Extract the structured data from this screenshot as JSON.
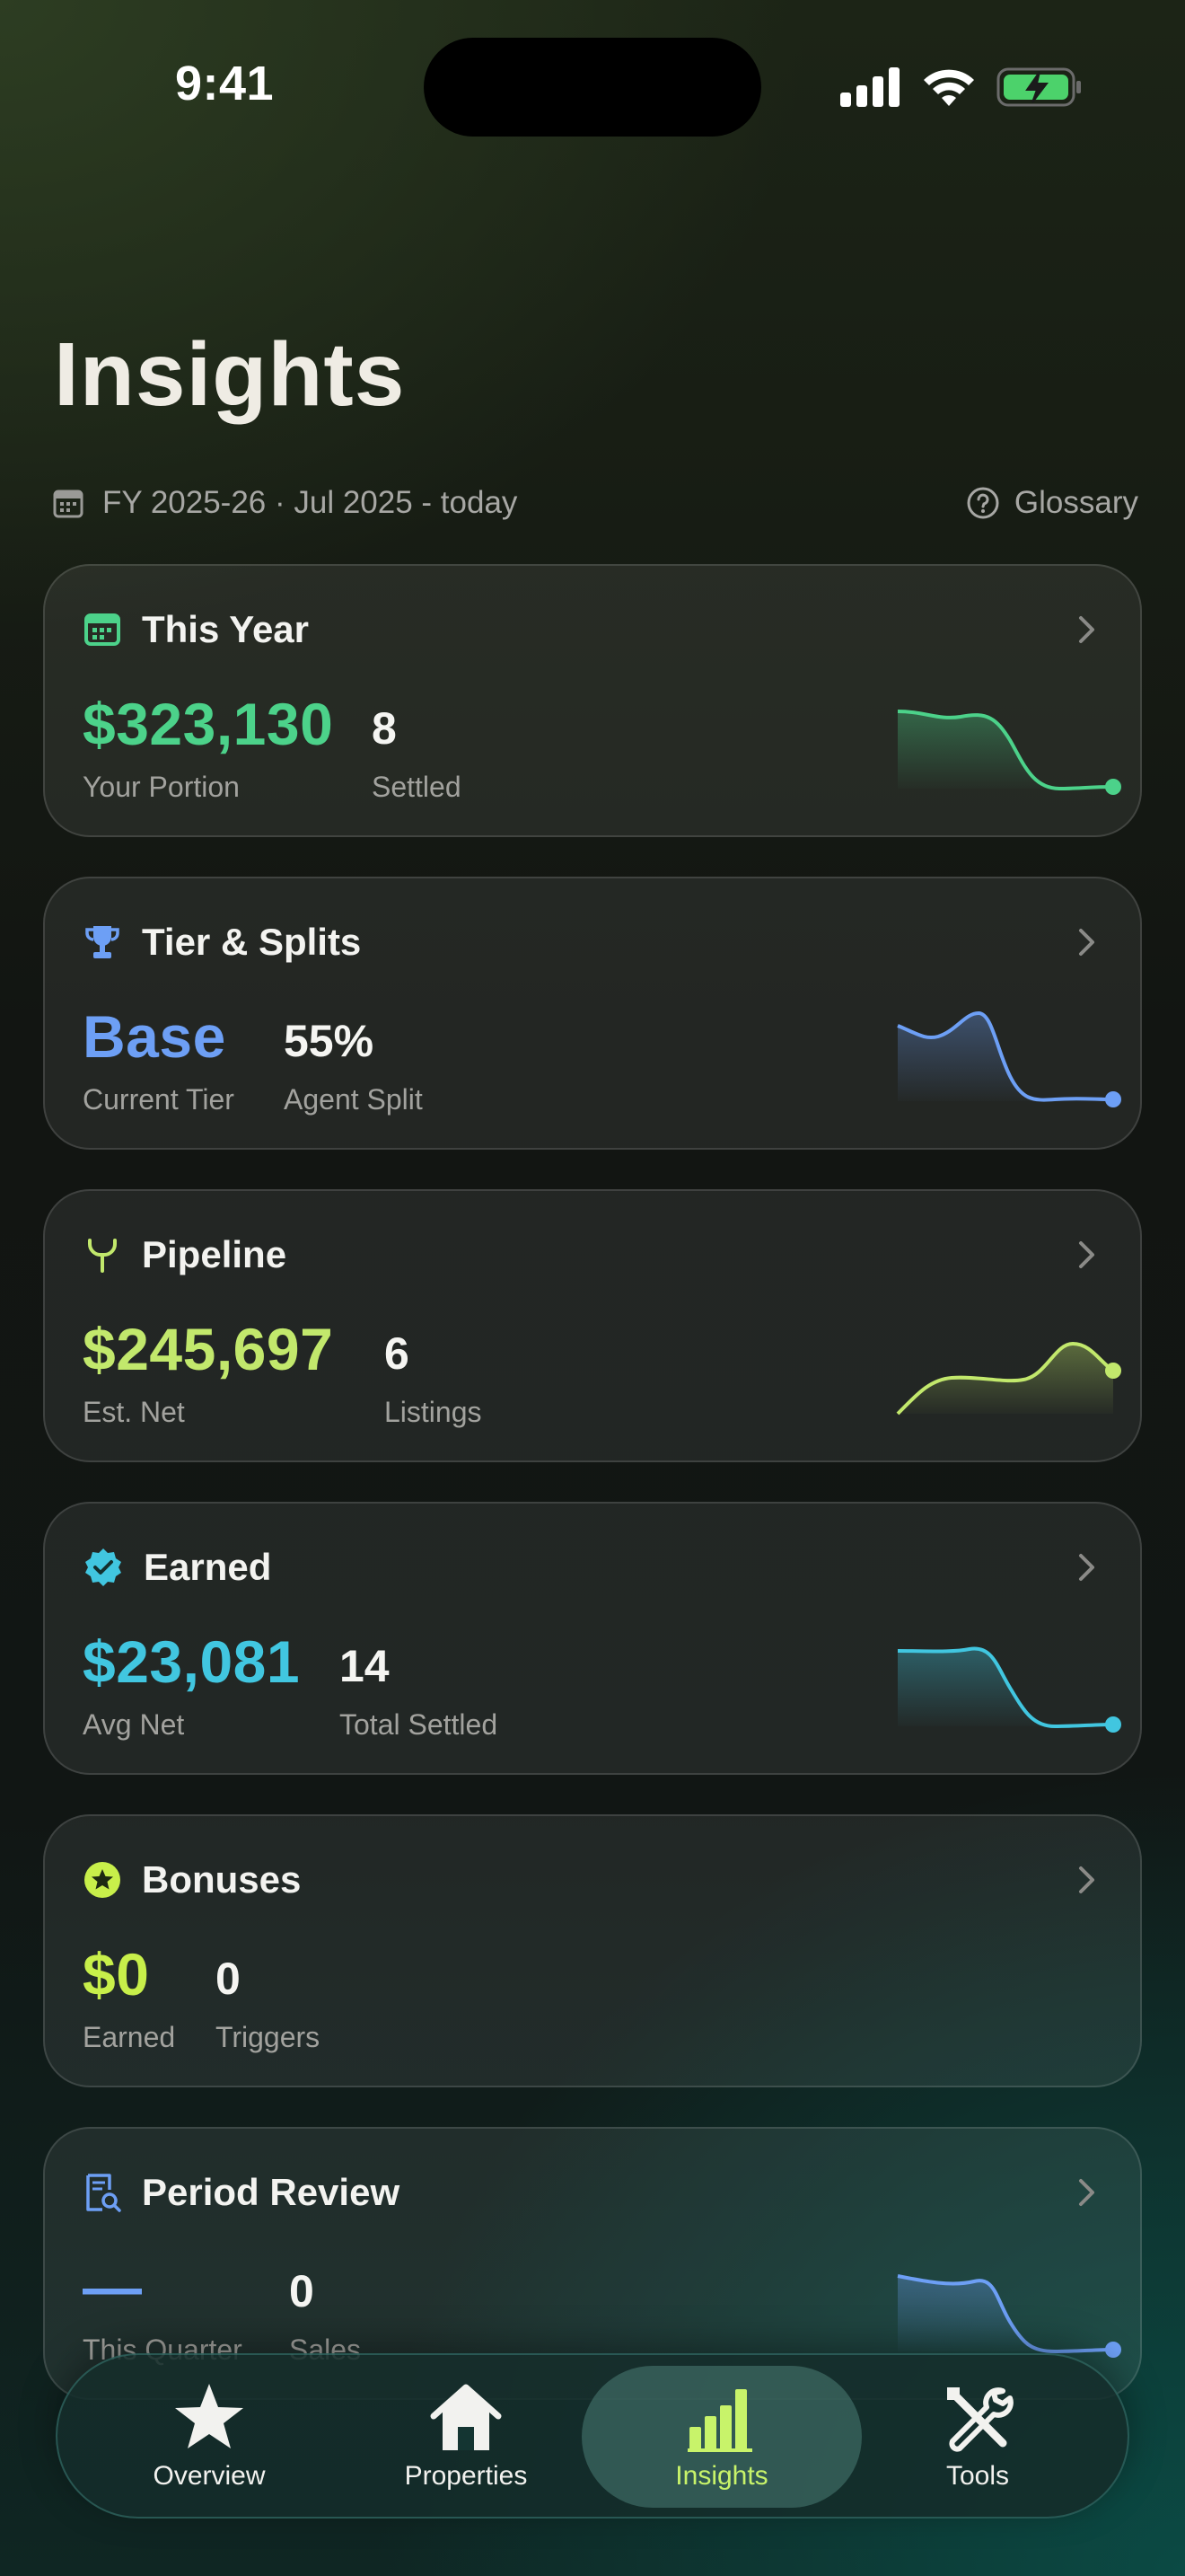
{
  "status_bar": {
    "time": "9:41"
  },
  "page": {
    "title": "Insights"
  },
  "subheader": {
    "period": "FY 2025-26 · Jul 2025 - today",
    "glossary": "Glossary"
  },
  "colors": {
    "green": "#4cd28a",
    "blue": "#6d9ff5",
    "lime": "#c2e86c",
    "cyan": "#41c6e0",
    "yellow": "#c8ef4a",
    "active_nav": "#c8f36a"
  },
  "cards": [
    {
      "icon": "calendar-icon",
      "title": "This Year",
      "main_value": "$323,130",
      "main_label": "Your Portion",
      "sec_value": "8",
      "sec_label": "Settled"
    },
    {
      "icon": "trophy-icon",
      "title": "Tier & Splits",
      "main_value": "Base",
      "main_label": "Current Tier",
      "sec_value": "55%",
      "sec_label": "Agent Split"
    },
    {
      "icon": "merge-icon",
      "title": "Pipeline",
      "main_value": "$245,697",
      "main_label": "Est. Net",
      "sec_value": "6",
      "sec_label": "Listings"
    },
    {
      "icon": "verified-badge-icon",
      "title": "Earned",
      "main_value": "$23,081",
      "main_label": "Avg Net",
      "sec_value": "14",
      "sec_label": "Total Settled"
    },
    {
      "icon": "star-circle-icon",
      "title": "Bonuses",
      "main_value": "$0",
      "main_label": "Earned",
      "sec_value": "0",
      "sec_label": "Triggers"
    },
    {
      "icon": "document-search-icon",
      "title": "Period Review",
      "main_value": "—",
      "main_label": "This Quarter",
      "sec_value": "0",
      "sec_label": "Sales"
    }
  ],
  "nav": [
    {
      "icon": "star-icon",
      "label": "Overview"
    },
    {
      "icon": "house-icon",
      "label": "Properties"
    },
    {
      "icon": "bar-chart-icon",
      "label": "Insights",
      "active": true
    },
    {
      "icon": "tools-icon",
      "label": "Tools"
    }
  ]
}
